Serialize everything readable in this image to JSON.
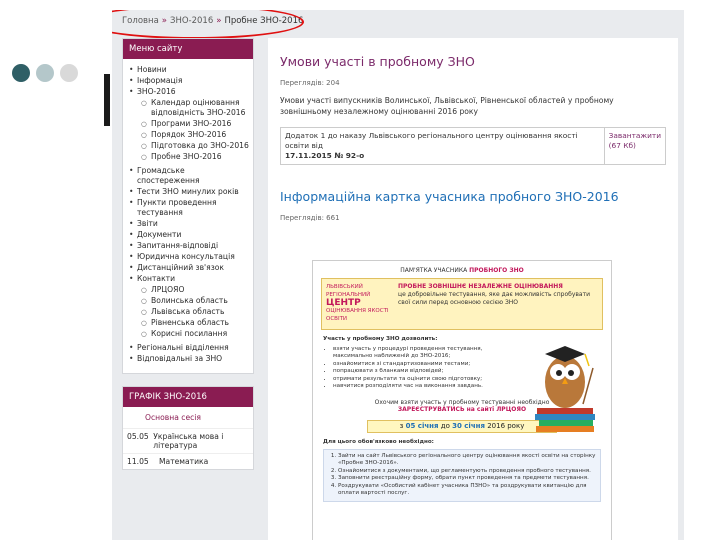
{
  "breadcrumb": {
    "home": "Головна",
    "sep": "»",
    "zno": "ЗНО-2016",
    "current": "Пробне ЗНО-2016"
  },
  "menu": {
    "title": "Меню сайту",
    "items": [
      {
        "label": "Новини",
        "type": "top"
      },
      {
        "label": "Інформація",
        "type": "top"
      },
      {
        "label": "ЗНО-2016",
        "type": "top"
      },
      {
        "label": "Календар оцінювання відповідність ЗНО-2016",
        "type": "sub"
      },
      {
        "label": "Програми ЗНО-2016",
        "type": "sub"
      },
      {
        "label": "Порядок ЗНО-2016",
        "type": "sub"
      },
      {
        "label": "Підготовка до ЗНО-2016",
        "type": "sub"
      },
      {
        "label": "Пробне ЗНО-2016",
        "type": "sub"
      },
      {
        "label": "Громадське спостереження",
        "type": "top",
        "gap": true
      },
      {
        "label": "Тести ЗНО минулих років",
        "type": "top"
      },
      {
        "label": "Пункти проведення тестування",
        "type": "top"
      },
      {
        "label": "Звіти",
        "type": "top"
      },
      {
        "label": "Документи",
        "type": "top"
      },
      {
        "label": "Запитання-відповіді",
        "type": "top"
      },
      {
        "label": "Юридична консультація",
        "type": "top"
      },
      {
        "label": "Дистанційний зв'язок",
        "type": "top"
      },
      {
        "label": "Контакти",
        "type": "top"
      },
      {
        "label": "ЛРЦОЯО",
        "type": "sub"
      },
      {
        "label": "Волинська область",
        "type": "sub"
      },
      {
        "label": "Львівська область",
        "type": "sub"
      },
      {
        "label": "Рівненська область",
        "type": "sub"
      },
      {
        "label": "Корисні посилання",
        "type": "sub"
      },
      {
        "label": "Регіональні відділення",
        "type": "top",
        "gap": true
      },
      {
        "label": "Відповідальні за ЗНО",
        "type": "top"
      }
    ]
  },
  "schedule": {
    "title": "ГРАФІК ЗНО-2016",
    "subtitle": "Основна сесія",
    "rows": [
      {
        "date": "05.05",
        "subject": "Українська мова і література"
      },
      {
        "date": "11.05",
        "subject": "Математика"
      }
    ]
  },
  "article1": {
    "title": "Умови участі в пробному ЗНО",
    "views": "Переглядів: 204",
    "text": "Умови участі випускників Волинської, Львівської, Рівненської областей у пробному зовнішньому незалежному оцінюванні 2016 року",
    "doc_left_1": "Додаток 1 до наказу Львівського регіонального центру оцінювання якості освіти від",
    "doc_left_2": "17.11.2015 № 92-о",
    "doc_right": "Завантажити (67 Кб)"
  },
  "article2": {
    "title": "Інформаційна картка учасника пробного ЗНО-2016",
    "views": "Переглядів: 661"
  },
  "card": {
    "top_prefix": "ПАМ'ЯТКА УЧАСНИКА",
    "top_highlight": "ПРОБНОГО ЗНО",
    "logo_small": "ЛЬВІВСЬКИЙ РЕГІОНАЛЬНИЙ",
    "logo_big": "ЦЕНТР",
    "logo_small2": "ОЦІНЮВАННЯ ЯКОСТІ ОСВІТИ",
    "banner_title": "ПРОБНЕ ЗОВНІШНЄ НЕЗАЛЕЖНЕ ОЦІНЮВАННЯ",
    "banner_text": "це добровільне тестування, яке дає можливість спробувати свої сили перед основною сесією ЗНО",
    "body_head": "Участь у пробному ЗНО дозволить:",
    "bullets": [
      "взяти участь у процедурі проведення тестування, максимально наближеній до ЗНО-2016;",
      "ознайомитися зі стандартизованими тестами;",
      "попрацювати з бланками відповідей;",
      "отримати результати та оцінити свою підготовку;",
      "навчитися розподіляти час на виконання завдань."
    ],
    "reg_text": "Охочим взяти участь у пробному тестуванні необхідно",
    "reg_highlight": "ЗАРЕЄСТРУВАТИСЬ на сайті ЛРЦОЯО",
    "dates_prefix": "з",
    "dates_from": "05 січня",
    "dates_mid": "до",
    "dates_to": "30 січня",
    "dates_suffix": "2016 року",
    "steps_head": "Для цього обов'язково необхідно:",
    "steps": [
      "Зайти на сайт Львівського регіонального центру оцінювання якості освіти на сторінку «Пробне ЗНО-2016».",
      "Ознайомитися з документами, що регламентують проведення пробного тестування.",
      "Заповнити реєстраційну форму, обрати пункт проведення та предмети тестування.",
      "Роздрукувати «Особистий кабінет учасника ПЗНО» та роздрукувати квитанцію для оплати вартості послуг."
    ]
  },
  "colors": {
    "accent": "#8a1c52",
    "title": "#7b2a6a",
    "link": "#1f6fb6",
    "annotation": "#e01010",
    "dot_dark": "#2f5f66",
    "dot_mid": "#b4c7ca",
    "dot_light": "#d9d9d9"
  }
}
